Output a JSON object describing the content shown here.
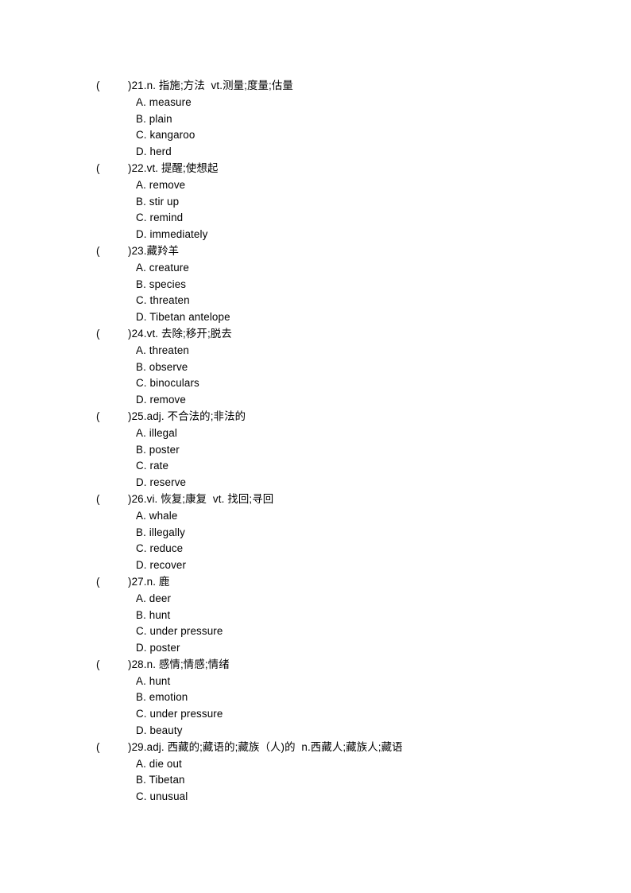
{
  "document": {
    "type": "vocabulary-multiple-choice-worksheet",
    "page_background": "#ffffff",
    "text_color": "#000000",
    "questions": [
      {
        "bracket_open": "(",
        "bracket_close": ")",
        "number": "21",
        "stem": "21.n. 指施;方法  vt.测量;度量;估量",
        "options": [
          "A. measure",
          "B. plain",
          "C. kangaroo",
          "D. herd"
        ]
      },
      {
        "bracket_open": "(",
        "bracket_close": ")",
        "number": "22",
        "stem": "22.vt. 提醒;使想起",
        "options": [
          "A. remove",
          "B. stir up",
          "C. remind",
          "D. immediately"
        ]
      },
      {
        "bracket_open": "(",
        "bracket_close": ")",
        "number": "23",
        "stem": "23.藏羚羊",
        "options": [
          "A. creature",
          "B. species",
          "C. threaten",
          "D. Tibetan antelope"
        ]
      },
      {
        "bracket_open": "(",
        "bracket_close": ")",
        "number": "24",
        "stem": "24.vt. 去除;移开;脱去",
        "options": [
          "A. threaten",
          "B. observe",
          "C. binoculars",
          "D. remove"
        ]
      },
      {
        "bracket_open": "(",
        "bracket_close": ")",
        "number": "25",
        "stem": "25.adj. 不合法的;非法的",
        "options": [
          "A. illegal",
          "B. poster",
          "C. rate",
          "D. reserve"
        ]
      },
      {
        "bracket_open": "(",
        "bracket_close": ")",
        "number": "26",
        "stem": "26.vi. 恢复;康复  vt. 找回;寻回",
        "options": [
          "A. whale",
          "B. illegally",
          "C. reduce",
          "D. recover"
        ]
      },
      {
        "bracket_open": "(",
        "bracket_close": ")",
        "number": "27",
        "stem": "27.n. 鹿",
        "options": [
          "A. deer",
          "B. hunt",
          "C. under pressure",
          "D. poster"
        ]
      },
      {
        "bracket_open": "(",
        "bracket_close": ")",
        "number": "28",
        "stem": "28.n. 感情;情感;情绪",
        "options": [
          "A. hunt",
          "B. emotion",
          "C. under pressure",
          "D. beauty"
        ]
      },
      {
        "bracket_open": "(",
        "bracket_close": ")",
        "number": "29",
        "stem": "29.adj. 西藏的;藏语的;藏族（人)的  n.西藏人;藏族人;藏语",
        "options": [
          "A. die out",
          "B. Tibetan",
          "C. unusual"
        ]
      }
    ]
  }
}
